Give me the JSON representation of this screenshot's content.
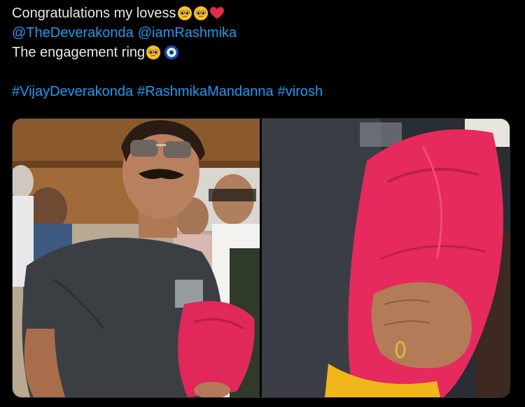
{
  "tweet": {
    "line1_text": "Congratulations my lovess",
    "line1_emojis": [
      "pleading-face-emoji",
      "pleading-face-emoji",
      "red-heart-emoji"
    ],
    "mention1": "@TheDeverakonda",
    "mention2": "@iamRashmika",
    "line3_text": "The engagement ring",
    "line3_emojis": [
      "pleading-face-emoji",
      "nazar-amulet-emoji"
    ],
    "hashtag1": "#VijayDeverakonda",
    "hashtag2": "#RashmikaMandanna",
    "hashtag3": "#virosh"
  },
  "media": {
    "photos": [
      {
        "description": "man with mustache and sunglasses in grey t-shirt holding pink bouquet"
      },
      {
        "description": "close-up of hand with ring holding pink bouquet"
      }
    ]
  },
  "colors": {
    "background": "#000000",
    "text": "#e7e9ea",
    "link": "#1d9bf0",
    "bouquet": "#e0285a"
  }
}
